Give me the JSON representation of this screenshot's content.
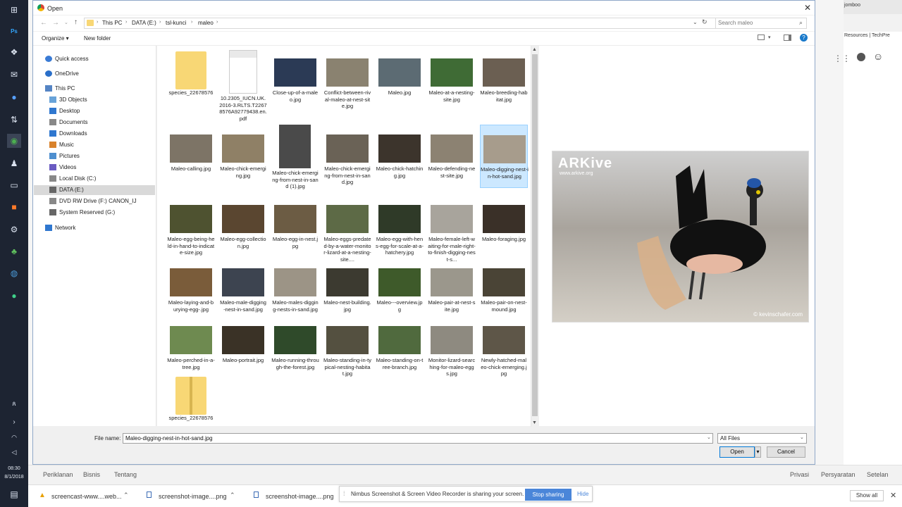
{
  "taskbar": {
    "icons": [
      "windows-icon",
      "photoshop-icon",
      "dropbox-icon",
      "mail-icon",
      "blue-circle-icon",
      "ftp-icon",
      "chrome-icon",
      "user-icon",
      "document-icon",
      "box-icon",
      "gear-icon",
      "clover-icon",
      "steam-icon",
      "green-icon",
      "people-icon",
      "chevron-right-icon",
      "wifi-icon",
      "speaker-icon",
      "notification-icon"
    ],
    "ps_label": "Ps",
    "time": "08:30",
    "date": "8/1/2018"
  },
  "background_browser": {
    "tab_label": "jomboo",
    "resources_label": "Resources | TechPre",
    "footer_links_left": [
      "Periklanan",
      "Bisnis",
      "Tentang"
    ],
    "footer_links_right": [
      "Privasi",
      "Persyaratan",
      "Setelan"
    ]
  },
  "downloads": {
    "items": [
      "screencast-www....web...",
      "screenshot-image....png",
      "screenshot-image....png"
    ],
    "show_all": "Show all"
  },
  "nimbus": {
    "message": "Nimbus Screenshot & Screen Video Recorder is sharing your screen.",
    "stop": "Stop sharing",
    "hide": "Hide"
  },
  "dialog": {
    "title": "Open",
    "breadcrumbs": [
      "This PC",
      "DATA (E:)",
      "tsl-kunci",
      "maleo"
    ],
    "search_placeholder": "Search maleo",
    "organize": "Organize ▾",
    "new_folder": "New folder",
    "nav": [
      {
        "label": "Quick access",
        "icon": "star-icon"
      },
      {
        "label": "OneDrive",
        "icon": "cloud-icon"
      },
      {
        "label": "This PC",
        "icon": "computer-icon"
      },
      {
        "label": "3D Objects",
        "icon": "cube-icon"
      },
      {
        "label": "Desktop",
        "icon": "desktop-icon"
      },
      {
        "label": "Documents",
        "icon": "documents-icon"
      },
      {
        "label": "Downloads",
        "icon": "download-icon"
      },
      {
        "label": "Music",
        "icon": "music-icon"
      },
      {
        "label": "Pictures",
        "icon": "pictures-icon"
      },
      {
        "label": "Videos",
        "icon": "videos-icon"
      },
      {
        "label": "Local Disk (C:)",
        "icon": "disk-icon"
      },
      {
        "label": "DATA (E:)",
        "icon": "drive-icon",
        "selected": true
      },
      {
        "label": "DVD RW Drive (F:) CANON_IJ",
        "icon": "dvd-icon"
      },
      {
        "label": "System Reserved (G:)",
        "icon": "drive-icon"
      },
      {
        "label": "Network",
        "icon": "network-icon"
      }
    ],
    "files": [
      {
        "name": "species_22678576",
        "kind": "folder"
      },
      {
        "name": "10.2305_IUCN.UK.2016-3.RLTS.T22678576A92779438.en.pdf",
        "kind": "pdf"
      },
      {
        "name": "Close-up-of-a-maleo.jpg",
        "kind": "img",
        "color": "#2b3a55"
      },
      {
        "name": "Conflict-between-rival-maleo-at-nest-site.jpg",
        "kind": "img",
        "color": "#8a8270"
      },
      {
        "name": "Maleo.jpg",
        "kind": "img",
        "color": "#5c6b73"
      },
      {
        "name": "Maleo-at-a-nesting-site.jpg",
        "kind": "img",
        "color": "#3f6b35"
      },
      {
        "name": "Maleo-breeding-habitat.jpg",
        "kind": "img",
        "color": "#6b5f52"
      },
      {
        "name": "Maleo-calling.jpg",
        "kind": "img",
        "color": "#7d7466"
      },
      {
        "name": "Maleo-chick-emerging.jpg",
        "kind": "img",
        "color": "#8f8066"
      },
      {
        "name": "Maleo-chick-emerging-from-nest-in-sand (1).jpg",
        "kind": "img",
        "color": "#4a4a4a"
      },
      {
        "name": "Maleo-chick-emerging-from-nest-in-sand.jpg",
        "kind": "img",
        "color": "#6a6256"
      },
      {
        "name": "Maleo-chick-hatching.jpg",
        "kind": "img",
        "color": "#3c342c"
      },
      {
        "name": "Maleo-defending-nest-site.jpg",
        "kind": "img",
        "color": "#8c8272"
      },
      {
        "name": "Maleo-digging-nest-in-hot-sand.jpg",
        "kind": "img",
        "color": "#a79c8c",
        "selected": true
      },
      {
        "name": "Maleo-egg-being-held-in-hand-to-indicate-size.jpg",
        "kind": "img",
        "color": "#4e5230"
      },
      {
        "name": "Maleo-egg-collection.jpg",
        "kind": "img",
        "color": "#5a4630"
      },
      {
        "name": "Maleo-egg-in-nest.jpg",
        "kind": "img",
        "color": "#6c5c44"
      },
      {
        "name": "Maleo-eggs-predated-by-a-water-monitor-lizard-at-a-nesting-site....",
        "kind": "img",
        "color": "#5d6a46"
      },
      {
        "name": "Maleo-egg-with-hens-egg-for-scale-at-a-hatchery.jpg",
        "kind": "img",
        "color": "#2f3a28"
      },
      {
        "name": "Maleo-female-left-waiting-for-male-right-to-finish-digging-nest-s...",
        "kind": "img",
        "color": "#a8a49c"
      },
      {
        "name": "Maleo-foraging.jpg",
        "kind": "img",
        "color": "#3a3028"
      },
      {
        "name": "Maleo-laying-and-burying-egg-.jpg",
        "kind": "img",
        "color": "#7a5c3a"
      },
      {
        "name": "Maleo-male-digging-nest-in-sand.jpg",
        "kind": "img",
        "color": "#3d4450"
      },
      {
        "name": "Maleo-males-digging-nests-in-sand.jpg",
        "kind": "img",
        "color": "#9c9486"
      },
      {
        "name": "Maleo-nest-building.jpg",
        "kind": "img",
        "color": "#3c3a30"
      },
      {
        "name": "Maleo---overview.jpg",
        "kind": "img",
        "color": "#3e5a2a"
      },
      {
        "name": "Maleo-pair-at-nest-site.jpg",
        "kind": "img",
        "color": "#9b978c"
      },
      {
        "name": "Maleo-pair-on-nest-mound.jpg",
        "kind": "img",
        "color": "#4a4436"
      },
      {
        "name": "Maleo-perched-in-a-tree.jpg",
        "kind": "img",
        "color": "#6e8a50"
      },
      {
        "name": "Maleo-portrait.jpg",
        "kind": "img",
        "color": "#3a3226"
      },
      {
        "name": "Maleo-running-through-the-forest.jpg",
        "kind": "img",
        "color": "#2f4a2a"
      },
      {
        "name": "Maleo-standing-in-typical-nesting-habitat.jpg",
        "kind": "img",
        "color": "#545040"
      },
      {
        "name": "Maleo-standing-on-tree-branch.jpg",
        "kind": "img",
        "color": "#506a3e"
      },
      {
        "name": "Monitor-lizard-searching-for-maleo-eggs.jpg",
        "kind": "img",
        "color": "#8e8a80"
      },
      {
        "name": "Newly-hatched-maleo-chick-emerging.jpg",
        "kind": "img",
        "color": "#5e5648"
      },
      {
        "name": "species_22678576",
        "kind": "zip"
      }
    ],
    "preview": {
      "brand": "ARKive",
      "url": "www.arkive.org",
      "credit": "© kevinschafer.com"
    },
    "file_name_label": "File name:",
    "file_name_value": "Maleo-digging-nest-in-hot-sand.jpg",
    "file_type": "All Files",
    "open": "Open",
    "cancel": "Cancel"
  }
}
